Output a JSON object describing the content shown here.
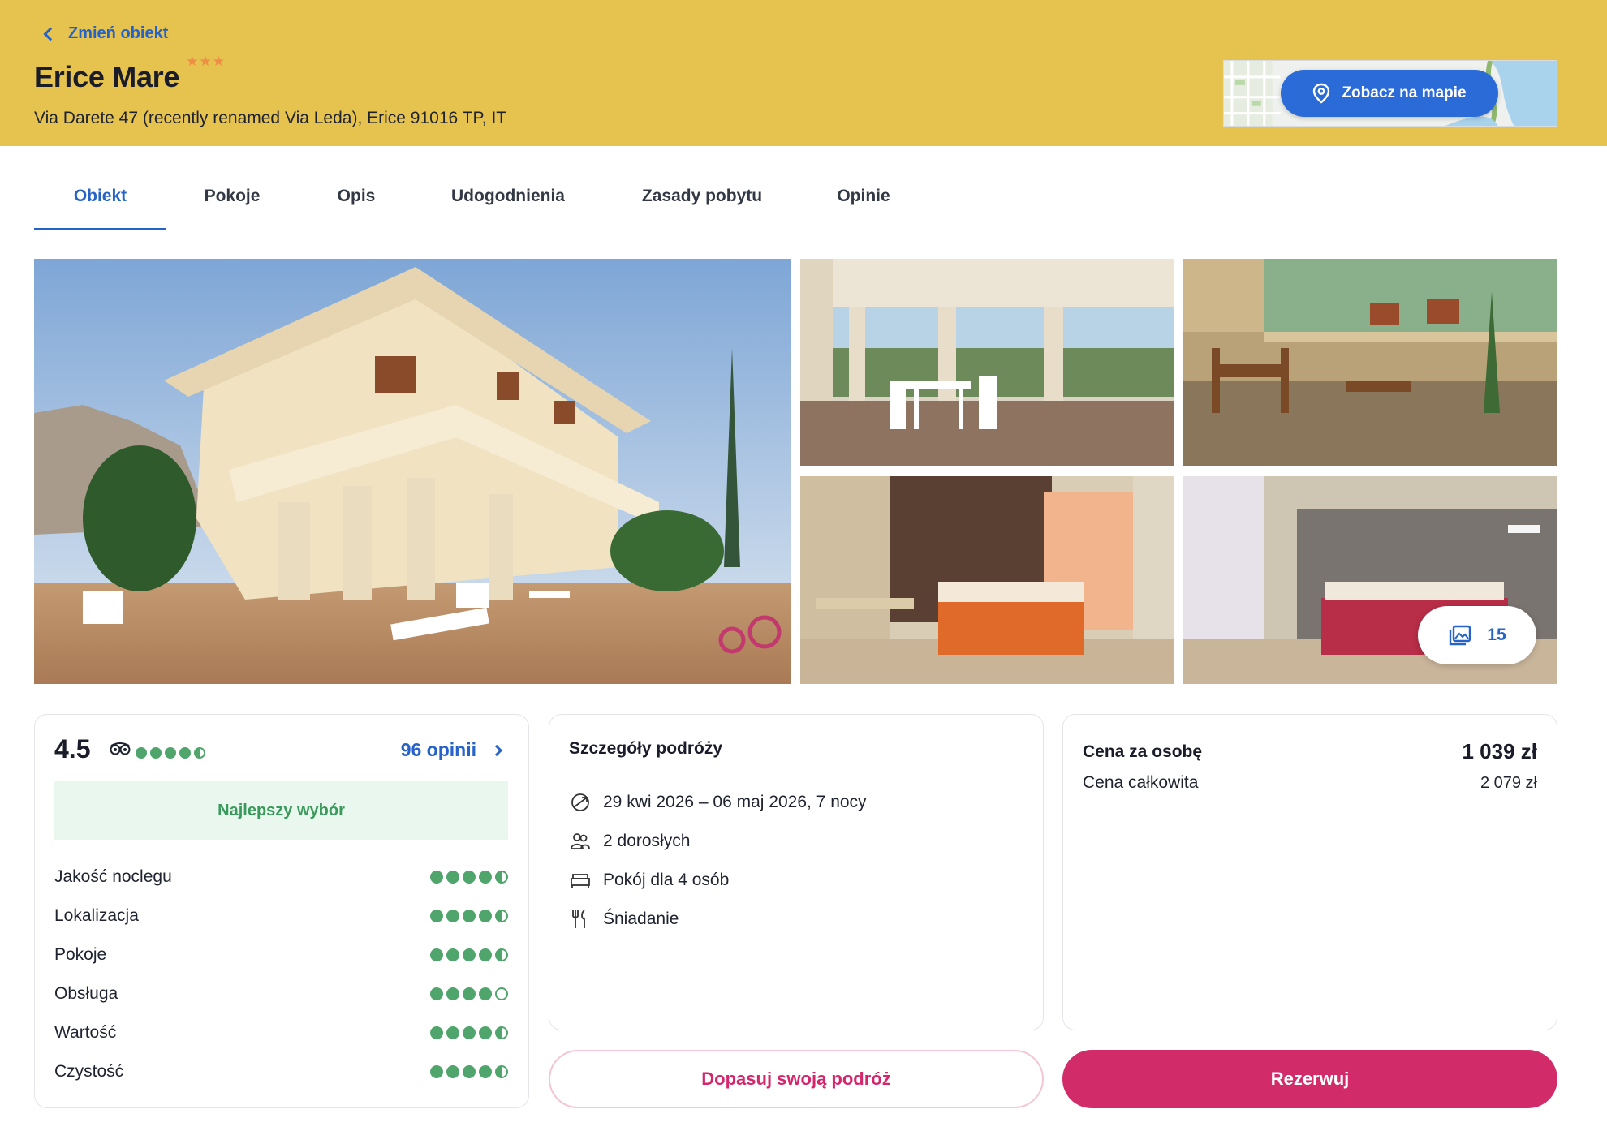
{
  "header": {
    "back_label": "Zmień obiekt",
    "hotel_name": "Erice Mare",
    "stars": "★★★",
    "address": "Via Darete 47 (recently renamed Via Leda), Erice 91016 TP, IT",
    "map_button": "Zobacz na mapie"
  },
  "tabs": [
    {
      "label": "Obiekt",
      "active": true
    },
    {
      "label": "Pokoje",
      "active": false
    },
    {
      "label": "Opis",
      "active": false
    },
    {
      "label": "Udogodnienia",
      "active": false
    },
    {
      "label": "Zasady pobytu",
      "active": false
    },
    {
      "label": "Opinie",
      "active": false
    }
  ],
  "gallery": {
    "photo_count": "15"
  },
  "rating": {
    "score": "4.5",
    "reviews_link": "96 opinii",
    "badge": "Najlepszy wybór",
    "overall_dots": 4.5,
    "categories": [
      {
        "label": "Jakość noclegu",
        "value": 4.5
      },
      {
        "label": "Lokalizacja",
        "value": 4.5
      },
      {
        "label": "Pokoje",
        "value": 4.5
      },
      {
        "label": "Obsługa",
        "value": 4.0
      },
      {
        "label": "Wartość",
        "value": 4.5
      },
      {
        "label": "Czystość",
        "value": 4.5
      }
    ],
    "dot_color": "#4fa56c"
  },
  "trip": {
    "title": "Szczegóły podróży",
    "dates": "29 kwi 2026 – 06 maj 2026, 7 nocy",
    "guests": "2 dorosłych",
    "room": "Pokój dla 4 osób",
    "board": "Śniadanie"
  },
  "price": {
    "per_person_label": "Cena za osobę",
    "per_person_value": "1 039 zł",
    "total_label": "Cena całkowita",
    "total_value": "2 079 zł"
  },
  "actions": {
    "customize": "Dopasuj swoją podróż",
    "book": "Rezerwuj"
  },
  "colors": {
    "header_bg": "#e6c24f",
    "accent_blue": "#2563c9",
    "accent_pink": "#d12b6a"
  }
}
